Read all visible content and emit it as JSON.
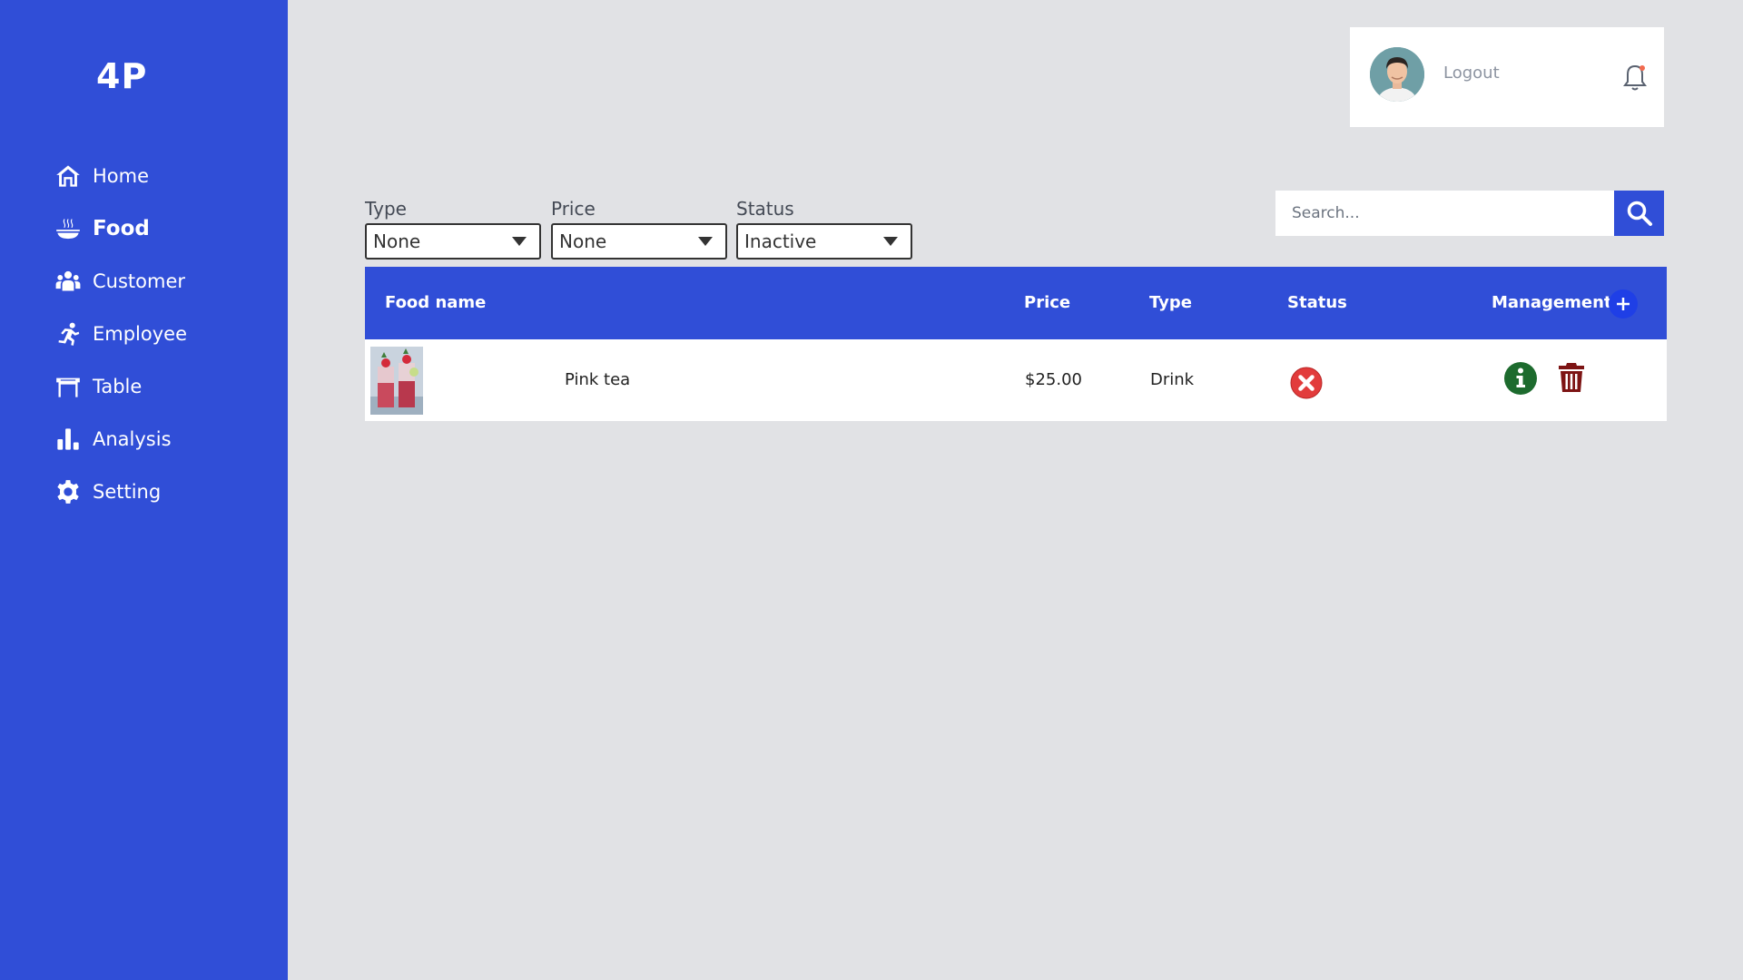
{
  "app": {
    "logo": "4P"
  },
  "sidebar": {
    "items": [
      {
        "label": "Home",
        "icon": "home-icon",
        "active": false
      },
      {
        "label": "Food",
        "icon": "food-bowl-icon",
        "active": true
      },
      {
        "label": "Customer",
        "icon": "customers-icon",
        "active": false
      },
      {
        "label": "Employee",
        "icon": "employee-icon",
        "active": false
      },
      {
        "label": "Table",
        "icon": "table-icon",
        "active": false
      },
      {
        "label": "Analysis",
        "icon": "bar-chart-icon",
        "active": false
      },
      {
        "label": "Setting",
        "icon": "gear-icon",
        "active": false
      }
    ]
  },
  "user": {
    "logout_label": "Logout",
    "avatar_icon": "user-avatar",
    "notification_icon": "bell-icon"
  },
  "filters": {
    "type": {
      "label": "Type",
      "value": "None"
    },
    "price": {
      "label": "Price",
      "value": "None"
    },
    "status": {
      "label": "Status",
      "value": "Inactive"
    }
  },
  "search": {
    "placeholder": "Search...",
    "value": ""
  },
  "table": {
    "headers": {
      "food_name": "Food name",
      "price": "Price",
      "type": "Type",
      "status": "Status",
      "management": "Management"
    },
    "rows": [
      {
        "name": "Pink tea",
        "price": "$25.00",
        "type": "Drink",
        "status": "inactive"
      }
    ]
  },
  "colors": {
    "primary": "#304ed7",
    "background": "#e1e2e5",
    "status_inactive": "#e23b3b",
    "info": "#1d6b2e",
    "delete": "#7d1414"
  }
}
